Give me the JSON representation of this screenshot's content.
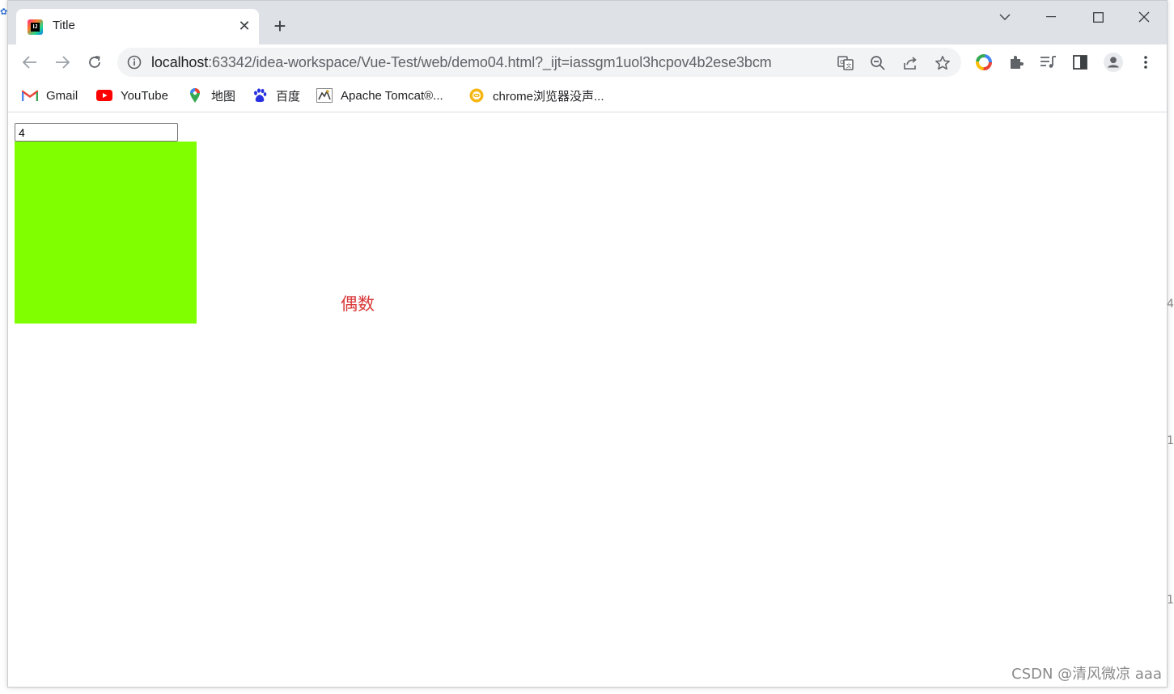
{
  "colors": {
    "box_fill": "#80ff00",
    "label_color": "#d93a3a"
  },
  "browser": {
    "tab_title": "Title",
    "url_host": "localhost",
    "url_rest": ":63342/idea-workspace/Vue-Test/web/demo04.html?_ijt=iassgm1uol3hcpov4b2ese3bcm"
  },
  "bookmarks": [
    {
      "label": "Gmail",
      "icon": "gmail-icon"
    },
    {
      "label": "YouTube",
      "icon": "youtube-icon"
    },
    {
      "label": "地图",
      "icon": "maps-icon"
    },
    {
      "label": "百度",
      "icon": "baidu-icon"
    },
    {
      "label": "Apache Tomcat®...",
      "icon": "tomcat-icon"
    },
    {
      "label": "chrome浏览器没声...",
      "icon": "chrome-help-icon"
    }
  ],
  "page": {
    "input_value": "4",
    "parity_label": "偶数"
  },
  "watermark": "CSDN @清风微凉 aaa"
}
